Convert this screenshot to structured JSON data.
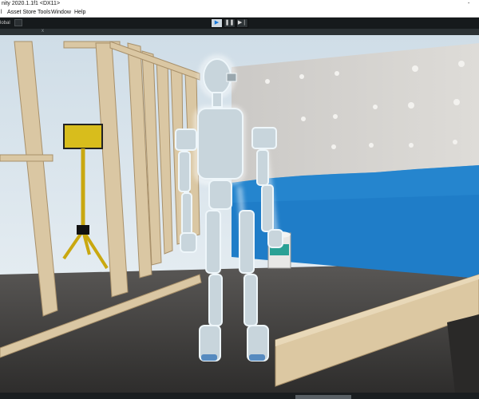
{
  "window": {
    "title_left": "nity 2020.1.1f1 <DX11>",
    "title_right": "-"
  },
  "menu": {
    "items": [
      "l",
      "Asset Store Tools",
      "Window",
      "Help"
    ]
  },
  "toolbar": {
    "global_label": "lobal",
    "play_glyph": "▶",
    "pause_glyph": "❚❚",
    "step_glyph": "▶❘"
  },
  "tab": {
    "close_glyph": "x"
  }
}
